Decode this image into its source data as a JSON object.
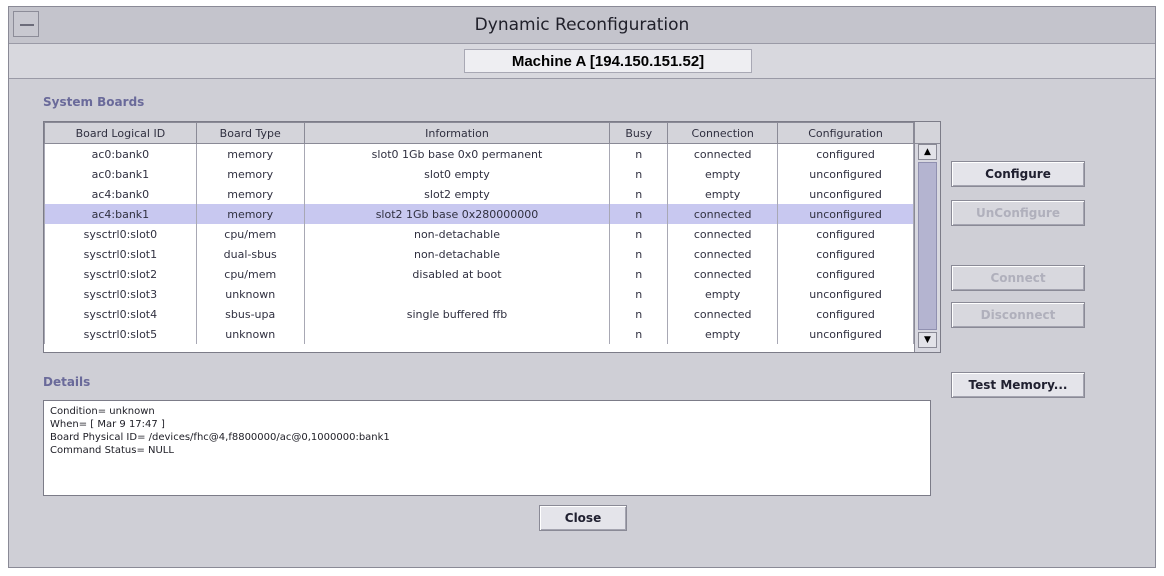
{
  "window": {
    "title": "Dynamic Reconfiguration",
    "machine": "Machine A [194.150.151.52]"
  },
  "system_boards": {
    "label": "System Boards",
    "columns": [
      "Board Logical ID",
      "Board Type",
      "Information",
      "Busy",
      "Connection",
      "Configuration"
    ],
    "rows": [
      [
        "ac0:bank0",
        "memory",
        "slot0 1Gb base 0x0 permanent",
        "n",
        "connected",
        "configured"
      ],
      [
        "ac0:bank1",
        "memory",
        "slot0 empty",
        "n",
        "empty",
        "unconfigured"
      ],
      [
        "ac4:bank0",
        "memory",
        "slot2 empty",
        "n",
        "empty",
        "unconfigured"
      ],
      [
        "ac4:bank1",
        "memory",
        "slot2 1Gb base 0x280000000",
        "n",
        "connected",
        "unconfigured"
      ],
      [
        "sysctrl0:slot0",
        "cpu/mem",
        "non-detachable",
        "n",
        "connected",
        "configured"
      ],
      [
        "sysctrl0:slot1",
        "dual-sbus",
        "non-detachable",
        "n",
        "connected",
        "configured"
      ],
      [
        "sysctrl0:slot2",
        "cpu/mem",
        "disabled at boot",
        "n",
        "connected",
        "configured"
      ],
      [
        "sysctrl0:slot3",
        "unknown",
        "",
        "n",
        "empty",
        "unconfigured"
      ],
      [
        "sysctrl0:slot4",
        "sbus-upa",
        "single buffered ffb",
        "n",
        "connected",
        "configured"
      ],
      [
        "sysctrl0:slot5",
        "unknown",
        "",
        "n",
        "empty",
        "unconfigured"
      ]
    ],
    "selected_row": 3
  },
  "buttons": {
    "configure": "Configure",
    "unconfigure": "UnConfigure",
    "connect": "Connect",
    "disconnect": "Disconnect",
    "test_memory": "Test Memory...",
    "close": "Close"
  },
  "details": {
    "label": "Details",
    "lines": [
      "Condition= unknown",
      "When= [ Mar 9 17:47 ]",
      "Board Physical ID= /devices/fhc@4,f8800000/ac@0,1000000:bank1",
      "Command Status= NULL"
    ]
  },
  "icons": {
    "window_menu": "window-menu-icon",
    "scroll_up": "scroll-up-icon",
    "scroll_down": "scroll-down-icon"
  },
  "colors": {
    "selected_row": "#c8c8f0",
    "section_label": "#6a6a9a",
    "window_bg": "#cfcfd6"
  }
}
